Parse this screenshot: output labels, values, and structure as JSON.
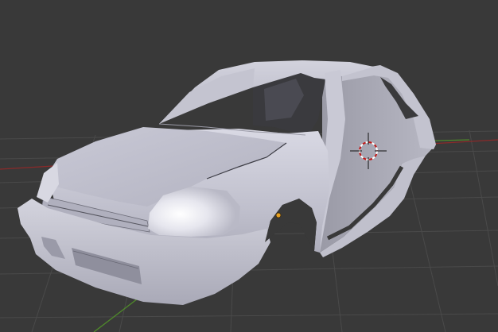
{
  "viewport": {
    "mode": "3d-viewport",
    "object": "car-body-shell",
    "shading": "solid",
    "background_color": "#393939",
    "grid_color": "#4a4a4a",
    "x_axis_color": "#8a2a2a",
    "y_axis_color": "#4f8a2a",
    "mesh_color": "#cdcdd9",
    "cursor_color": "#c01818",
    "origin_color": "#e8a020"
  }
}
